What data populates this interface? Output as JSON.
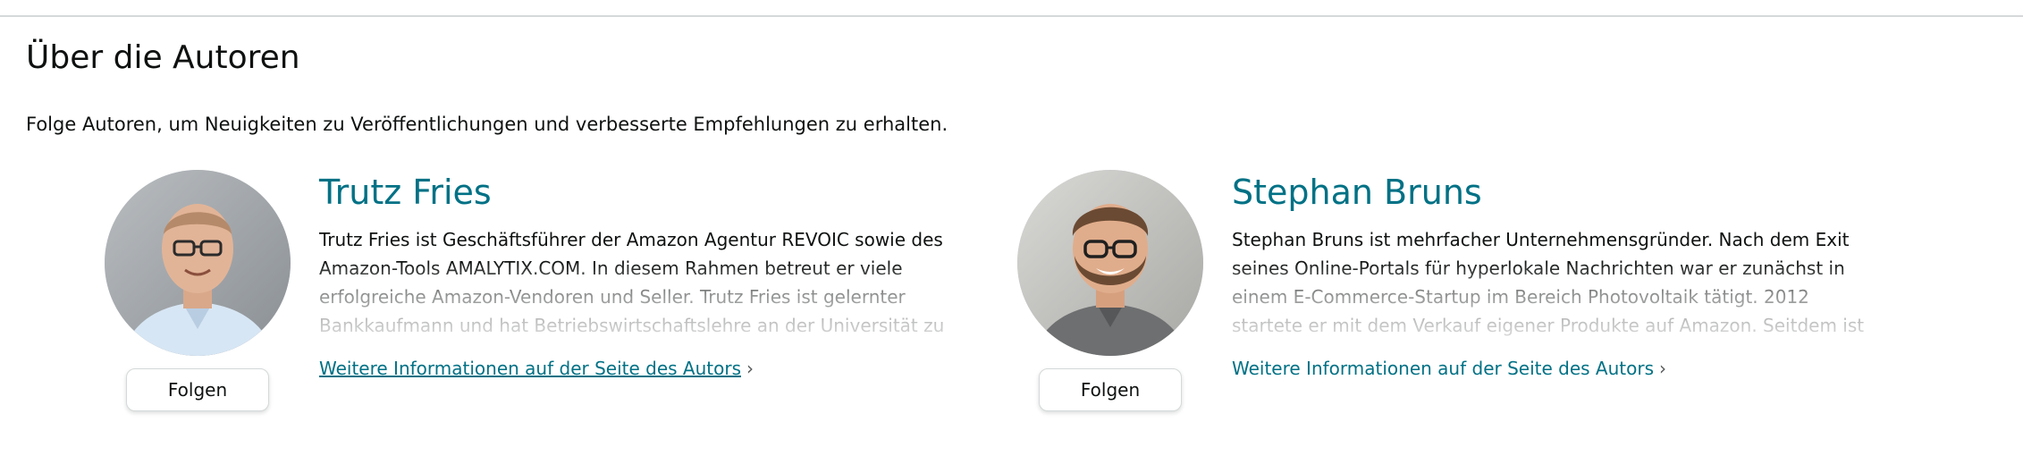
{
  "section": {
    "title": "Über die Autoren",
    "subtitle": "Folge Autoren, um Neuigkeiten zu Veröffentlichungen und verbesserte Empfehlungen zu erhalten."
  },
  "authors": [
    {
      "name": "Trutz Fries",
      "bio_lines": [
        "Trutz Fries ist Geschäftsführer der Amazon Agentur REVOIC sowie des",
        "Amazon-Tools AMALYTIX.COM. In diesem Rahmen betreut er viele",
        "erfolgreiche Amazon-Vendoren und Seller. Trutz Fries ist gelernter",
        "Bankkaufmann und hat Betriebswirtschaftslehre an der Universität zu"
      ],
      "follow_label": "Folgen",
      "more_link_label": "Weitere Informationen auf der Seite des Autors",
      "more_link_icon": "chevron-right-icon"
    },
    {
      "name": "Stephan Bruns",
      "bio_lines": [
        "Stephan Bruns ist mehrfacher Unternehmensgründer. Nach dem Exit",
        "seines Online-Portals für hyperlokale Nachrichten war er zunächst in",
        "einem E-Commerce-Startup im Bereich Photovoltaik tätigt. 2012",
        "startete er mit dem Verkauf eigener Produkte auf Amazon. Seitdem ist"
      ],
      "follow_label": "Folgen",
      "more_link_label": "Weitere Informationen auf der Seite des Autors",
      "more_link_icon": "chevron-right-icon"
    }
  ],
  "colors": {
    "link": "#007185",
    "text": "#0f1111",
    "divider": "#d5d9d9"
  }
}
